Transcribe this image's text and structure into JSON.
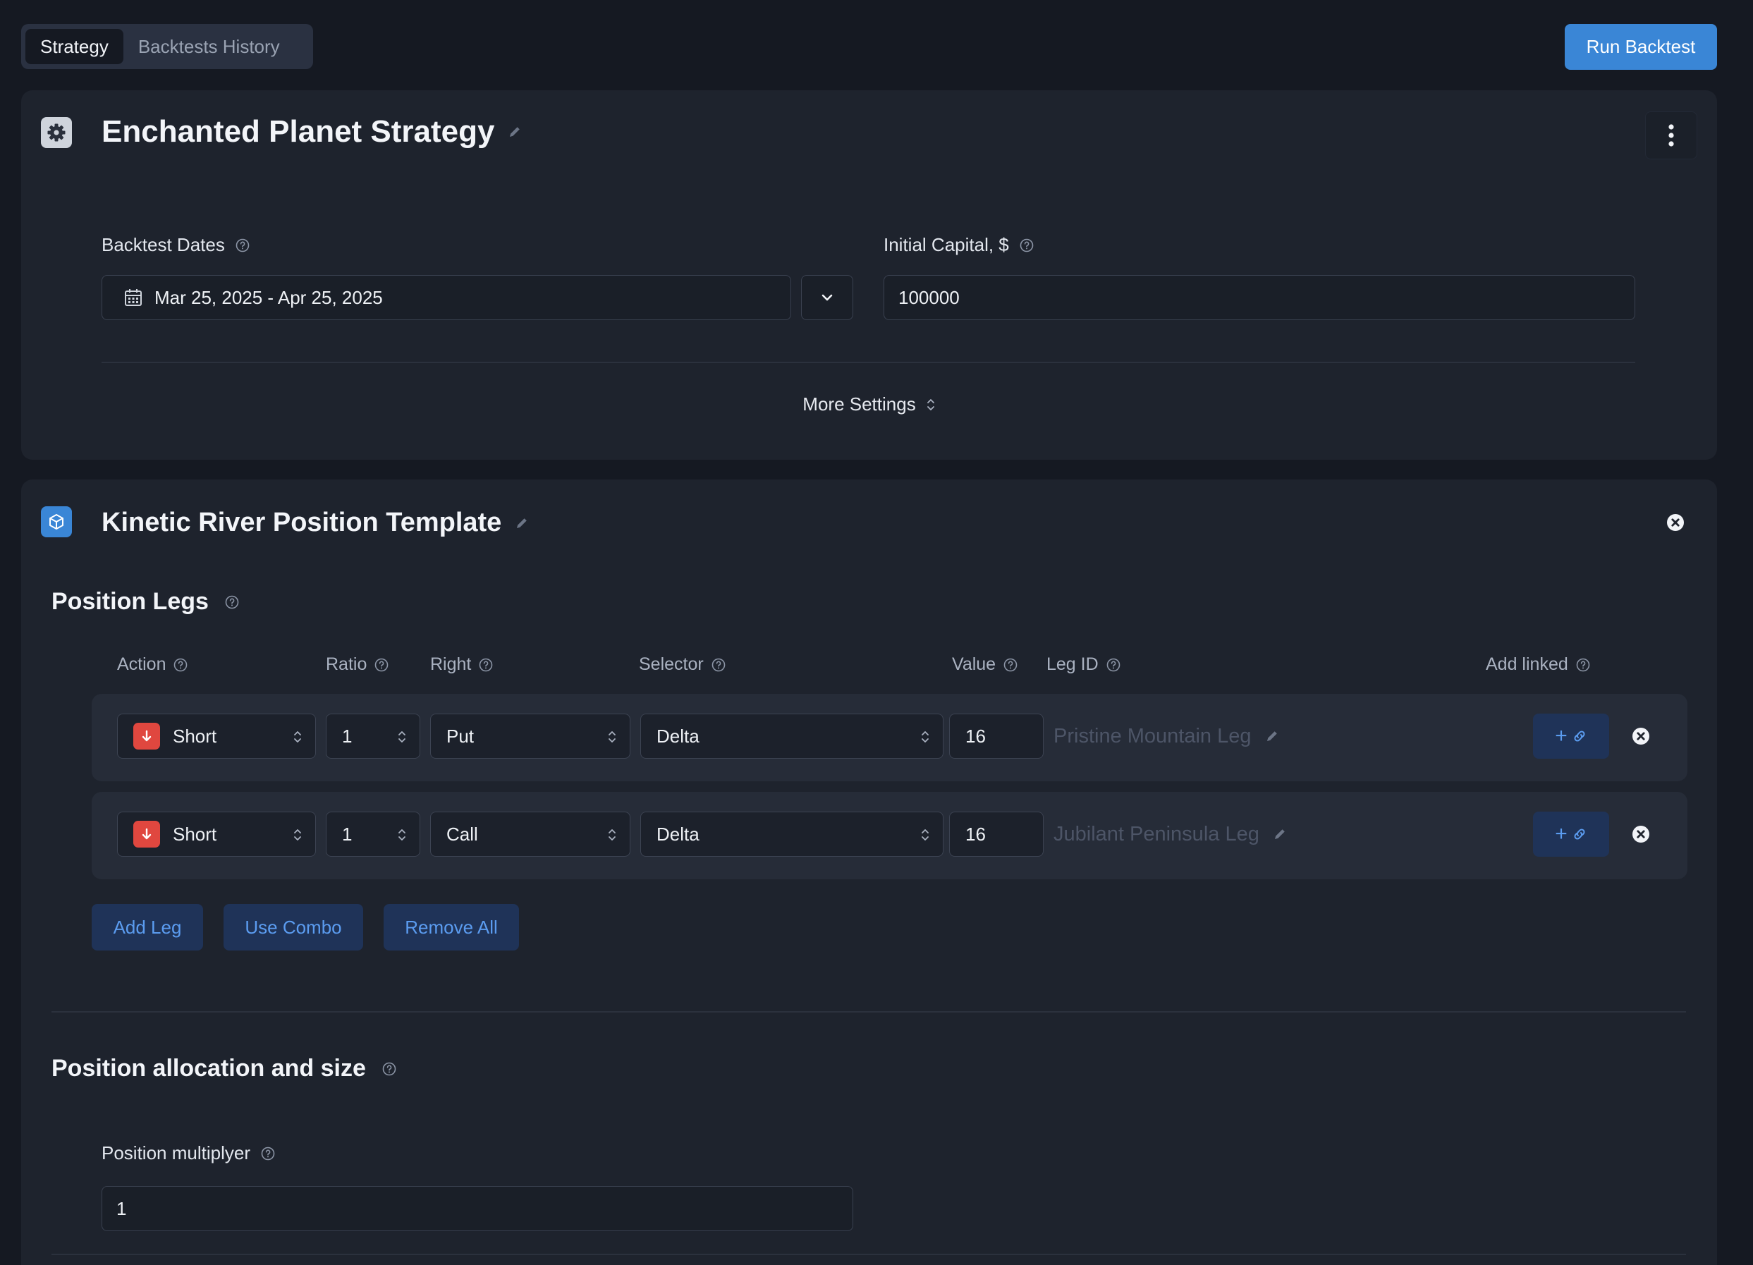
{
  "tabs": [
    {
      "label": "Strategy",
      "active": true
    },
    {
      "label": "Backtests History",
      "active": false
    }
  ],
  "run_button": "Run Backtest",
  "strategy": {
    "title": "Enchanted Planet Strategy",
    "dates_label": "Backtest Dates",
    "dates_value": "Mar 25, 2025 - Apr 25, 2025",
    "capital_label": "Initial Capital, $",
    "capital_value": "100000",
    "more_settings": "More Settings"
  },
  "template": {
    "title": "Kinetic River Position Template",
    "legs_title": "Position Legs",
    "columns": {
      "action": "Action",
      "ratio": "Ratio",
      "right": "Right",
      "selector": "Selector",
      "value": "Value",
      "leg_id": "Leg ID",
      "add_linked": "Add linked"
    },
    "legs": [
      {
        "action": "Short",
        "ratio": "1",
        "right": "Put",
        "selector": "Delta",
        "value": "16",
        "leg_id": "Pristine Mountain Leg"
      },
      {
        "action": "Short",
        "ratio": "1",
        "right": "Call",
        "selector": "Delta",
        "value": "16",
        "leg_id": "Jubilant Peninsula Leg"
      }
    ],
    "buttons": {
      "add_leg": "Add Leg",
      "use_combo": "Use Combo",
      "remove_all": "Remove All"
    },
    "allocation_title": "Position allocation and size",
    "multiplier_label": "Position multiplyer",
    "multiplier_value": "1"
  },
  "colors": {
    "background": "#151922",
    "card": "#1e232d",
    "accent": "#3a86d6",
    "short_badge": "#e0473f",
    "link_blue": "#5b9cf0"
  },
  "icons": {
    "strategy": "gear-icon",
    "template": "cube-icon",
    "dates": "calendar-icon",
    "help": "question-circle-icon",
    "edit": "pencil-icon",
    "menu": "kebab-icon",
    "close": "close-circle-icon",
    "short": "arrow-down-icon",
    "link": "plus-link-icon"
  }
}
